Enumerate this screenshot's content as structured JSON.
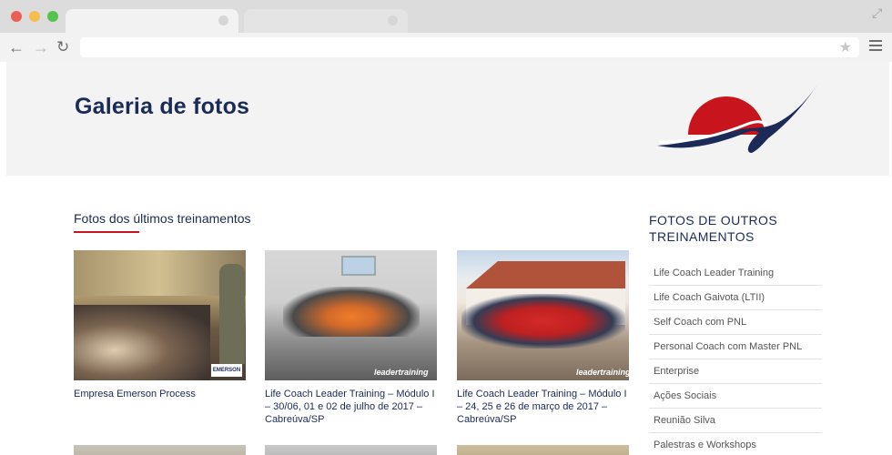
{
  "browser": {
    "address": "",
    "controls": {
      "close": "#ec5f57",
      "minimize": "#f5be4f",
      "maximize": "#58c24f"
    }
  },
  "hero": {
    "title": "Galeria de fotos"
  },
  "section": {
    "title": "Fotos dos últimos treinamentos"
  },
  "gallery": [
    {
      "caption": "Empresa Emerson Process",
      "badge": "EMERSON"
    },
    {
      "caption": "Life Coach Leader Training – Módulo I – 30/06, 01 e 02 de julho de 2017 – Cabreúva/SP",
      "watermark": "leadertraining"
    },
    {
      "caption": "Life Coach Leader Training – Módulo I – 24, 25 e 26 de março de 2017 – Cabreúva/SP",
      "watermark": "leadertraining"
    }
  ],
  "sidebar": {
    "title": "FOTOS DE OUTROS TREINAMENTOS",
    "items": [
      "Life Coach Leader Training",
      "Life Coach Gaivota (LTII)",
      "Self Coach com PNL",
      "Personal Coach com Master PNL",
      "Enterprise",
      "Ações Sociais",
      "Reunião Silva",
      "Palestras e Workshops"
    ]
  },
  "colors": {
    "brand_navy": "#1b2a57",
    "brand_red": "#c8151d"
  }
}
